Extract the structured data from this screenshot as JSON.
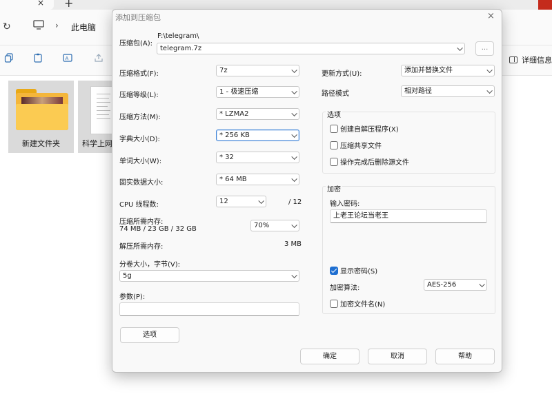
{
  "explorer": {
    "tab_close": "×",
    "tab_new": "+",
    "breadcrumb": "此电脑",
    "details_label": "详细信息",
    "files": [
      {
        "name": "新建文件夹"
      },
      {
        "name": "科学上网"
      }
    ]
  },
  "dialog": {
    "title": "添加到压缩包",
    "close": "×",
    "archive_label": "压缩包(A):",
    "archive_path": "F:\\telegram\\",
    "archive_name": "telegram.7z",
    "browse_button": "...",
    "format_label": "压缩格式(F):",
    "format_value": "7z",
    "level_label": "压缩等级(L):",
    "level_value": "1 - 极速压缩",
    "method_label": "压缩方法(M):",
    "method_value": "* LZMA2",
    "dict_label": "字典大小(D):",
    "dict_value": "* 256 KB",
    "word_label": "单词大小(W):",
    "word_value": "* 32",
    "solid_label": "固实数据大小:",
    "solid_value": "* 64 MB",
    "cpu_label": "CPU 线程数:",
    "cpu_value": "12",
    "cpu_total": "/ 12",
    "mem_comp_label": "压缩所需内存:",
    "mem_comp_value": "74 MB / 23 GB / 32 GB",
    "mem_percent": "70%",
    "mem_decomp_label": "解压所需内存:",
    "mem_decomp_value": "3 MB",
    "split_label": "分卷大小，字节(V):",
    "split_value": "5g",
    "params_label": "参数(P):",
    "params_value": "",
    "options_button": "选项",
    "update_label": "更新方式(U):",
    "update_value": "添加并替换文件",
    "path_label": "路径模式",
    "path_value": "相对路径",
    "options_group": "选项",
    "opt_sfx": "创建自解压程序(X)",
    "opt_shared": "压缩共享文件",
    "opt_delete": "操作完成后删除源文件",
    "encrypt_group": "加密",
    "password_label": "输入密码:",
    "password_value": "上老王论坛当老王",
    "show_password": "显示密码(S)",
    "show_password_checked": true,
    "enc_method_label": "加密算法:",
    "enc_method_value": "AES-256",
    "encrypt_names": "加密文件名(N)",
    "ok_button": "确定",
    "cancel_button": "取消",
    "help_button": "帮助"
  },
  "colors": {
    "accent": "#1f6fd1",
    "close_red": "#c42b1c",
    "folder_yellow": "#f4b63b"
  }
}
